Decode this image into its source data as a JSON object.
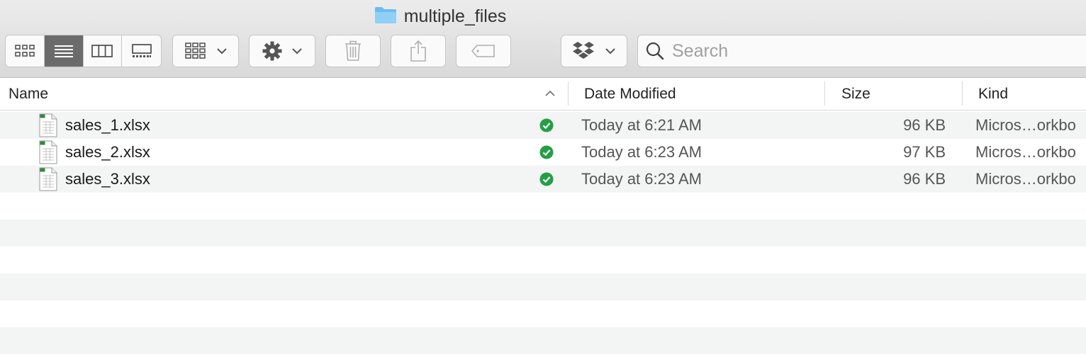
{
  "window": {
    "title": "multiple_files"
  },
  "toolbar": {
    "view_modes": [
      {
        "name": "icon-view",
        "active": false
      },
      {
        "name": "list-view",
        "active": true
      },
      {
        "name": "column-view",
        "active": false
      },
      {
        "name": "gallery-view",
        "active": false
      }
    ],
    "search_placeholder": "Search"
  },
  "columns": {
    "name": "Name",
    "date": "Date Modified",
    "size": "Size",
    "kind": "Kind"
  },
  "files": [
    {
      "name": "sales_1.xlsx",
      "date": "Today at 6:21 AM",
      "size": "96 KB",
      "kind": "Micros…orkbo",
      "synced": true
    },
    {
      "name": "sales_2.xlsx",
      "date": "Today at 6:23 AM",
      "size": "97 KB",
      "kind": "Micros…orkbo",
      "synced": true
    },
    {
      "name": "sales_3.xlsx",
      "date": "Today at 6:23 AM",
      "size": "96 KB",
      "kind": "Micros…orkbo",
      "synced": true
    }
  ],
  "colors": {
    "accent_folder": "#6bbcf0",
    "sync_ok": "#23a043",
    "selected_segment": "#6b6b6b"
  }
}
